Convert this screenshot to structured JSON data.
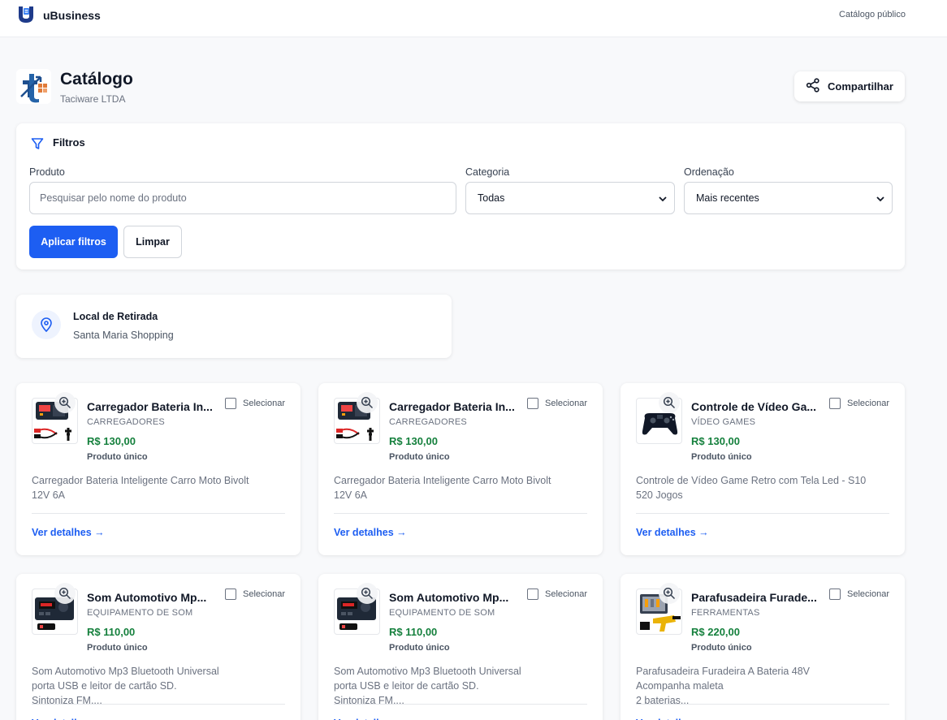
{
  "topbar": {
    "brand": "uBusiness",
    "public_link": "Catálogo público"
  },
  "header": {
    "title": "Catálogo",
    "company": "Taciware LTDA",
    "share_label": "Compartilhar"
  },
  "filters": {
    "title": "Filtros",
    "product_label": "Produto",
    "product_placeholder": "Pesquisar pelo nome do produto",
    "product_value": "",
    "category_label": "Categoria",
    "category_value": "Todas",
    "order_label": "Ordenação",
    "order_value": "Mais recentes",
    "apply_label": "Aplicar filtros",
    "clear_label": "Limpar"
  },
  "pickup": {
    "title": "Local de Retirada",
    "place": "Santa Maria Shopping"
  },
  "select_label": "Selecionar",
  "details_label": "Ver detalhes →",
  "products": [
    {
      "name": "Carregador Bateria In...",
      "category": "CARREGADORES",
      "price": "R$ 130,00",
      "kind": "Produto único",
      "description": [
        "Carregador Bateria Inteligente Carro Moto Bivolt",
        "12V 6A"
      ],
      "icon": "charger-image"
    },
    {
      "name": "Carregador Bateria In...",
      "category": "CARREGADORES",
      "price": "R$ 130,00",
      "kind": "Produto único",
      "description": [
        "Carregador Bateria Inteligente Carro Moto Bivolt",
        "12V 6A"
      ],
      "icon": "charger-image"
    },
    {
      "name": "Controle de Vídeo Ga...",
      "category": "VÍDEO GAMES",
      "price": "R$ 130,00",
      "kind": "Produto único",
      "description": [
        "Controle de Vídeo Game Retro com Tela Led - S10",
        "520 Jogos"
      ],
      "icon": "gamepad-image"
    },
    {
      "name": "Som Automotivo Mp...",
      "category": "EQUIPAMENTO DE SOM",
      "price": "R$ 110,00",
      "kind": "Produto único",
      "description": [
        "Som Automotivo Mp3 Bluetooth Universal",
        "porta USB e leitor de cartão SD.",
        "Sintoniza FM...."
      ],
      "icon": "car-stereo-image"
    },
    {
      "name": "Som Automotivo Mp...",
      "category": "EQUIPAMENTO DE SOM",
      "price": "R$ 110,00",
      "kind": "Produto único",
      "description": [
        "Som Automotivo Mp3 Bluetooth Universal",
        "porta USB e leitor de cartão SD.",
        "Sintoniza FM...."
      ],
      "icon": "car-stereo-image"
    },
    {
      "name": "Parafusadeira Furade...",
      "category": "FERRAMENTAS",
      "price": "R$ 220,00",
      "kind": "Produto único",
      "description": [
        "Parafusadeira Furadeira A Bateria 48V",
        "Acompanha maleta",
        "2 baterias..."
      ],
      "icon": "drill-kit-image"
    }
  ],
  "colors": {
    "primary": "#1d5ef2",
    "price": "#15803d",
    "background": "#f8f9fb"
  }
}
